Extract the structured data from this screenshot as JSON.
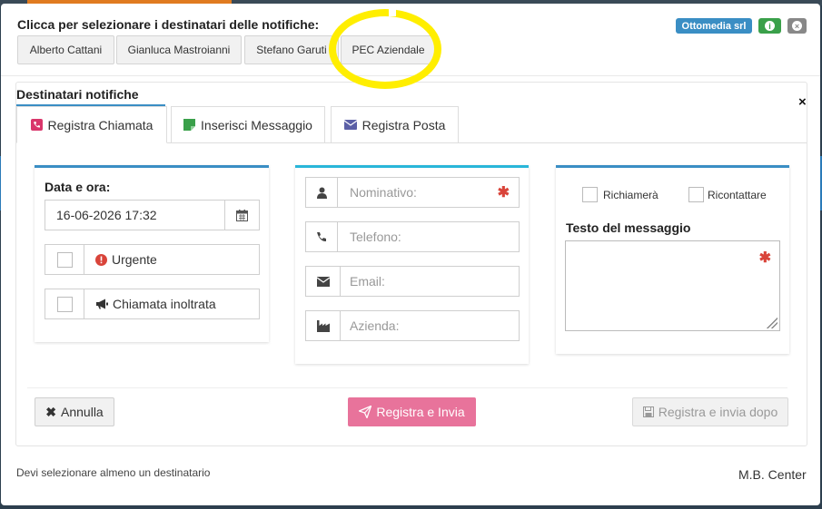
{
  "header": {
    "title": "Clicca per selezionare i destinatari delle notifiche:",
    "recipients": [
      "Alberto Cattani",
      "Gianluca Mastroianni",
      "Stefano Garuti",
      "PEC Aziendale"
    ],
    "company_badge": "Ottomedia srl",
    "info_glyph": "i",
    "close_glyph": "×"
  },
  "panel": {
    "title": "Destinatari notifiche",
    "close_glyph": "×",
    "tabs": [
      {
        "label": "Registra Chiamata",
        "icon": "phone-icon",
        "color": "#d9366b"
      },
      {
        "label": "Inserisci Messaggio",
        "icon": "note-icon",
        "color": "#3aa04a"
      },
      {
        "label": "Registra Posta",
        "icon": "envelope-icon",
        "color": "#5b5fa6"
      }
    ]
  },
  "call": {
    "datetime_label": "Data e ora:",
    "datetime_value": "16-06-2026 17:32",
    "urgent_label": "Urgente",
    "forwarded_label": "Chiamata inoltrata"
  },
  "contact": {
    "name_placeholder": "Nominativo:",
    "phone_placeholder": "Telefono:",
    "email_placeholder": "Email:",
    "company_placeholder": "Azienda:",
    "required_glyph": "✱"
  },
  "message": {
    "call_back_label": "Richiamerà",
    "recontact_label": "Ricontattare",
    "text_label": "Testo del messaggio"
  },
  "actions": {
    "cancel": "Annulla",
    "send": "Registra e Invia",
    "send_later": "Registra e invia dopo"
  },
  "footer": {
    "hint": "Devi selezionare almeno un destinatario",
    "brand": "M.B. Center"
  },
  "colors": {
    "accent_blue": "#3a8ec4",
    "accent_cyan": "#29b6d9",
    "send_pink": "#e8739b",
    "highlight": "#ffee00"
  }
}
